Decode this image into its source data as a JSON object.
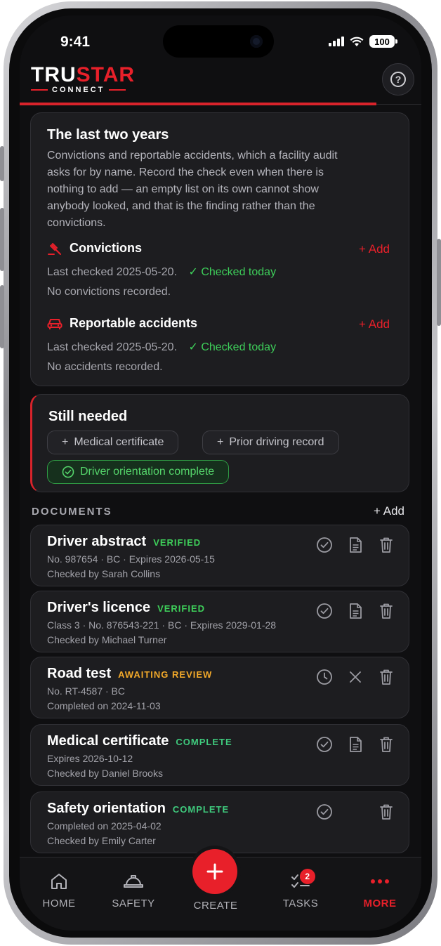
{
  "status_bar": {
    "time": "9:41",
    "battery": "100"
  },
  "header": {
    "logo_main_a": "TRU",
    "logo_main_b": "STAR",
    "logo_sub": "CONNECT"
  },
  "last_two_years": {
    "title": "The last two years",
    "description": "Convictions and reportable accidents, which a facility audit asks for by name. Record the check even when there is nothing to add — an empty list on its own cannot show anybody looked, and that is the finding rather than the convictions.",
    "convictions": {
      "label": "Convictions",
      "add_label": "Add",
      "last_checked": "Last checked 2025-05-20.",
      "checked_today": "Checked today",
      "empty": "No convictions recorded."
    },
    "accidents": {
      "label": "Reportable accidents",
      "add_label": "Add",
      "last_checked": "Last checked 2025-05-20.",
      "checked_today": "Checked today",
      "empty": "No accidents recorded."
    }
  },
  "still_needed": {
    "title": "Still needed",
    "chips": [
      "Medical certificate",
      "Prior driving record",
      "Driver orientation complete"
    ]
  },
  "documents": {
    "section_label": "DOCUMENTS",
    "add_label": "Add",
    "items": [
      {
        "title": "Driver abstract",
        "badge": "VERIFIED",
        "line1": "No. 987654 · BC · Expires 2026-05-15",
        "line2": "Checked by Sarah Collins"
      },
      {
        "title": "Driver's licence",
        "badge": "VERIFIED",
        "line1": "Class 3 · No. 876543-221 · BC · Expires 2029-01-28",
        "line2": "Checked by Michael Turner"
      },
      {
        "title": "Road test",
        "badge": "AWAITING REVIEW",
        "line1": "No. RT-4587 · BC",
        "line2": "Completed on 2024-11-03"
      },
      {
        "title": "Medical certificate",
        "badge": "COMPLETE",
        "line1": "Expires 2026-10-12",
        "line2": "Checked by Daniel Brooks"
      },
      {
        "title": "Safety orientation",
        "badge": "COMPLETE",
        "line1": "Completed on 2025-04-02",
        "line2": "Checked by Emily Carter"
      }
    ]
  },
  "bottom_nav": {
    "home": "HOME",
    "safety": "SAFETY",
    "create": "CREATE",
    "tasks": "TASKS",
    "tasks_badge": "2",
    "more": "MORE"
  },
  "colors": {
    "accent_red": "#e8202a",
    "verified_green": "#3ecf5a",
    "complete_green": "#3fca7d",
    "awaiting_amber": "#f2a92a"
  }
}
